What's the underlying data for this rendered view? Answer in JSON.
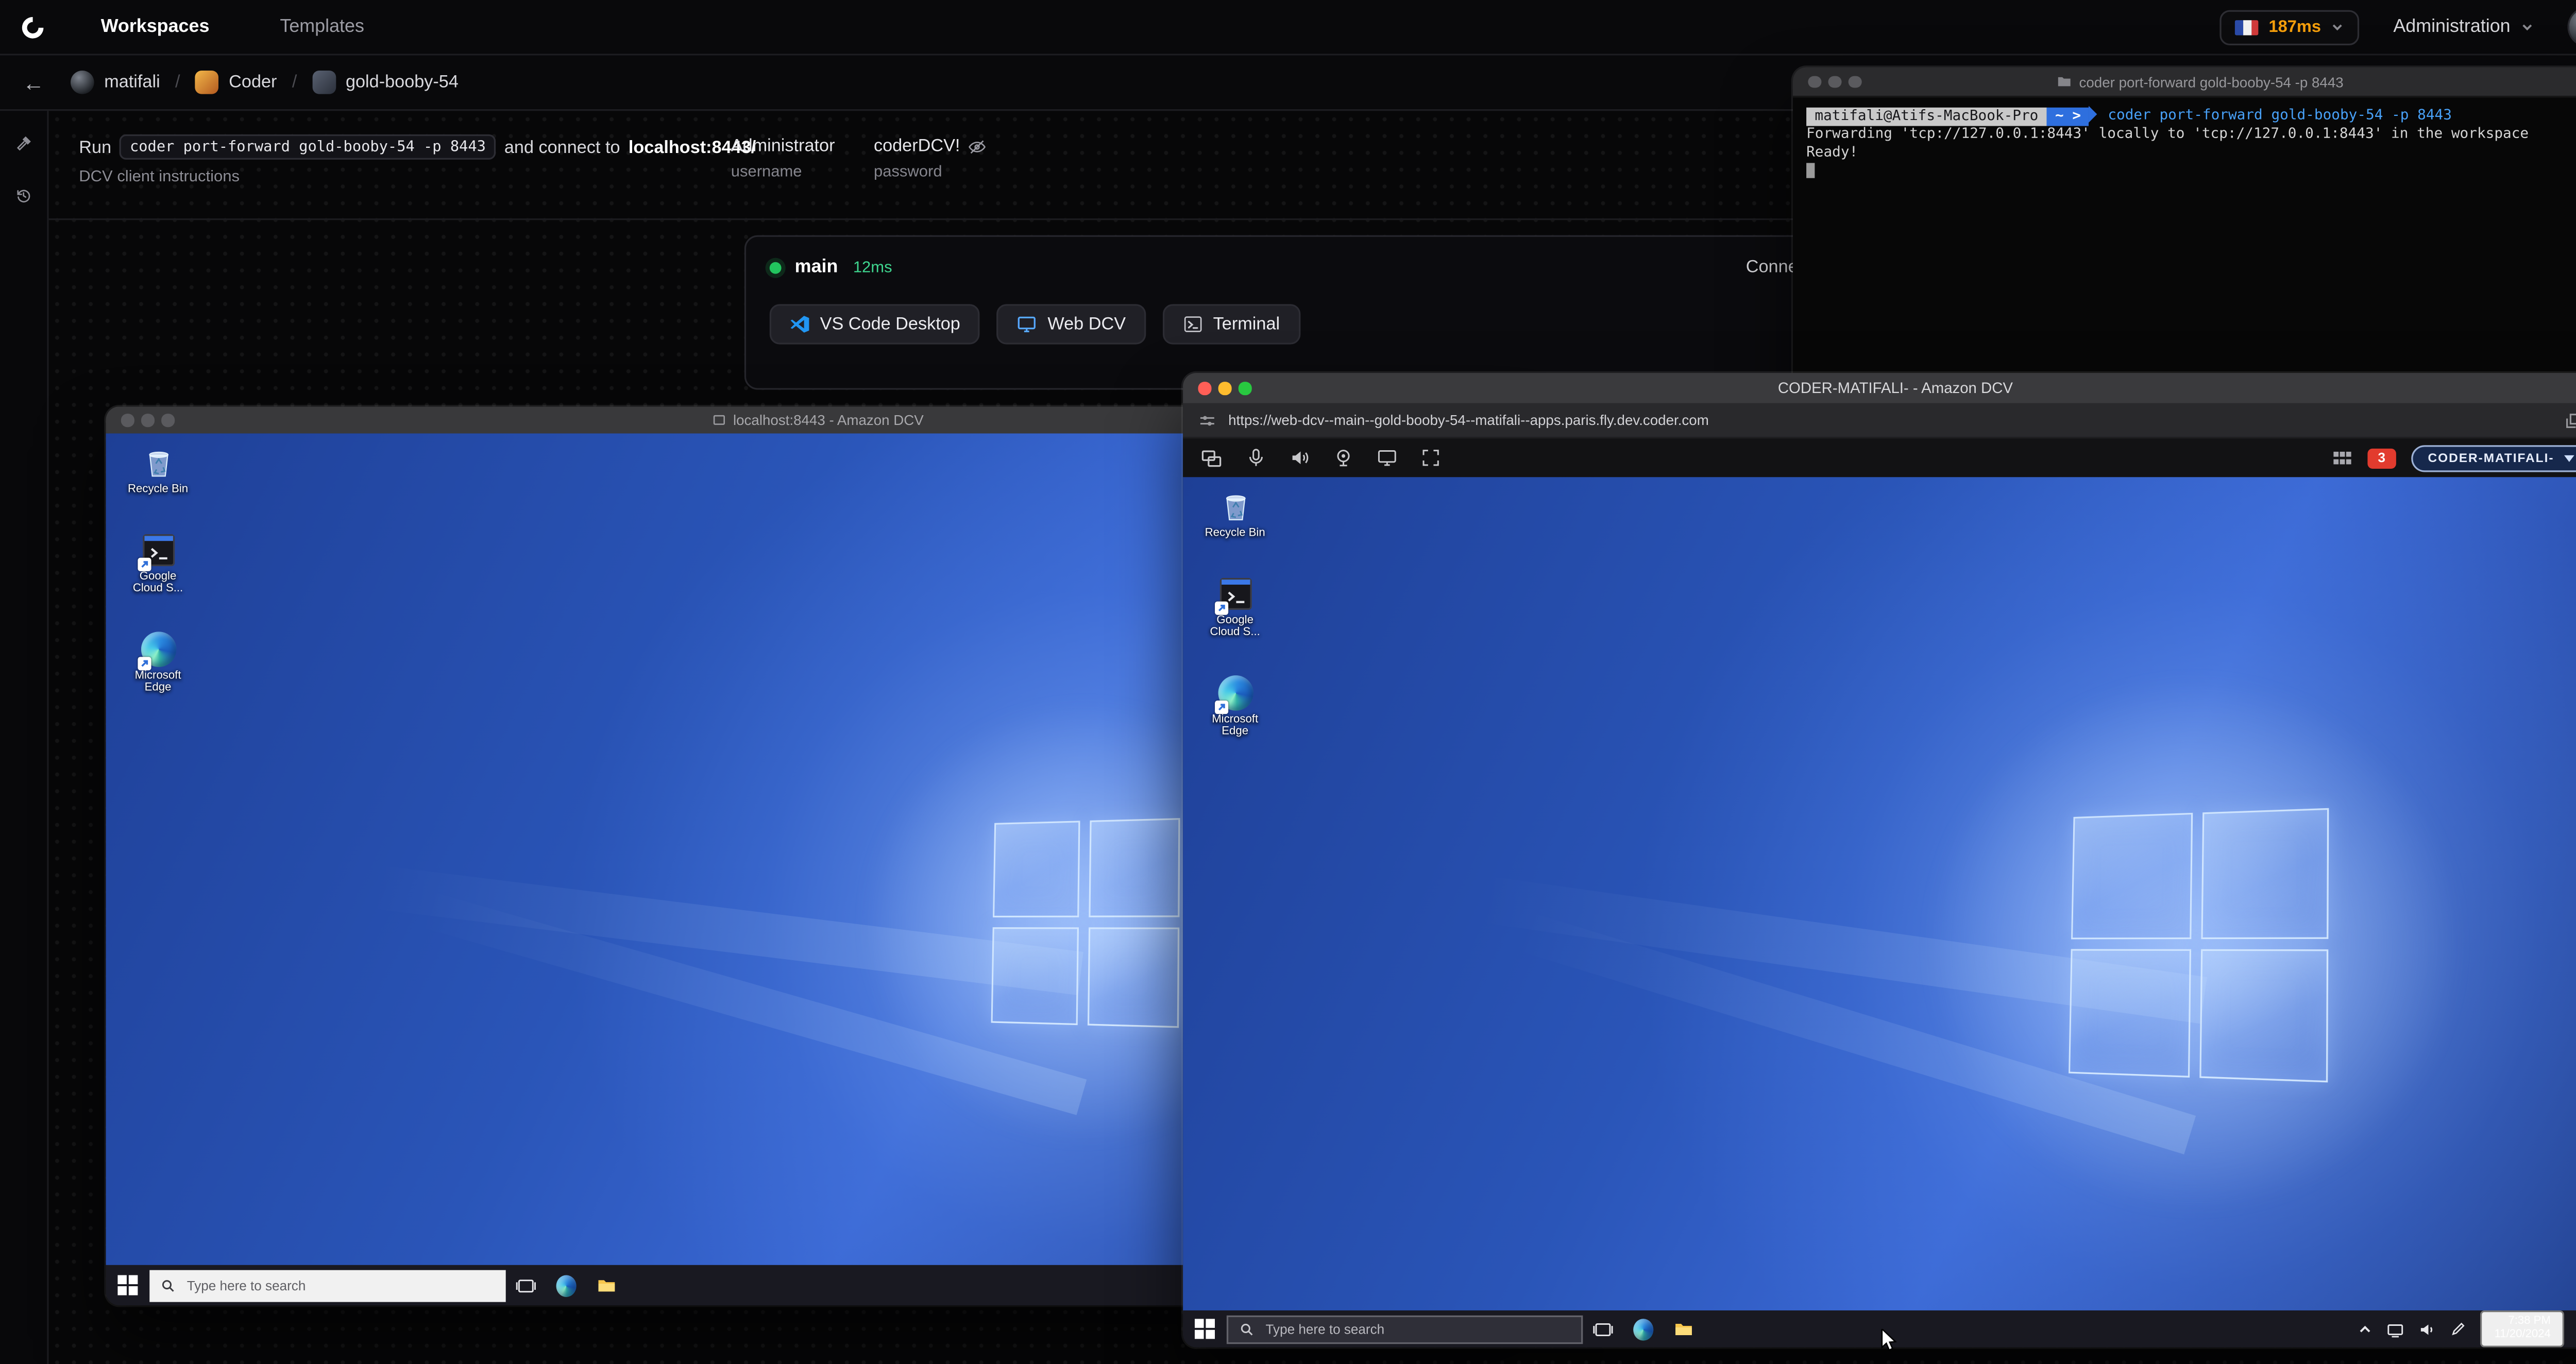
{
  "colors": {
    "accent_green": "#22c55e",
    "latency_warning": "#f59e0b",
    "badge_red": "#e23b2e",
    "windows_blue": "#2a55b8",
    "prompt_blue": "#2e6fde"
  },
  "navbar": {
    "workspaces": "Workspaces",
    "templates": "Templates",
    "latency": "187ms",
    "administration": "Administration"
  },
  "breadcrumb": {
    "back_icon": "←",
    "separator": "/",
    "owner": "matifali",
    "template": "Coder",
    "workspace": "gold-booby-54"
  },
  "header": {
    "run_prefix": "Run",
    "command": "coder port-forward gold-booby-54 -p 8443",
    "connect_middle": "and connect to",
    "connect_target": "localhost:8443/",
    "instructions": "DCV client instructions",
    "username_value": "Administrator",
    "username_label": "username",
    "password_value": "coderDCV!",
    "password_label": "password"
  },
  "agent": {
    "name": "main",
    "latency": "12ms",
    "ssh": "Connect via SSH",
    "apps": {
      "vscode": "VS Code Desktop",
      "webdcv": "Web DCV",
      "terminal": "Terminal"
    }
  },
  "terminal": {
    "title": "coder port-forward gold-booby-54 -p 8443",
    "prompt_user": "matifali@Atifs-MacBook-Pro",
    "prompt_path": "~",
    "prompt_symbol": ">",
    "command": "coder port-forward gold-booby-54 -p 8443",
    "line1": "Forwarding 'tcp://127.0.0.1:8443' locally to 'tcp://127.0.0.1:8443' in the workspace",
    "line2": "Ready!"
  },
  "dcv_local": {
    "title": "localhost:8443 - Amazon DCV",
    "icons": {
      "recycle": {
        "line1": "Recycle Bin",
        "line2": ""
      },
      "gcloud": {
        "line1": "Google",
        "line2": "Cloud S..."
      },
      "edge": {
        "line1": "Microsoft",
        "line2": "Edge"
      }
    },
    "search_placeholder": "Type here to search"
  },
  "dcv_web": {
    "title": "CODER-MATIFALI- - Amazon DCV",
    "url": "https://web-dcv--main--gold-booby-54--matifali--apps.paris.fly.dev.coder.com",
    "badge": "3",
    "session_name": "CODER-MATIFALI-",
    "icons": {
      "recycle": {
        "line1": "Recycle Bin",
        "line2": ""
      },
      "gcloud": {
        "line1": "Google",
        "line2": "Cloud S..."
      },
      "edge": {
        "line1": "Microsoft",
        "line2": "Edge"
      }
    },
    "search_placeholder": "Type here to search",
    "clock_time": "7:38 PM",
    "clock_date": "11/20/2024"
  }
}
